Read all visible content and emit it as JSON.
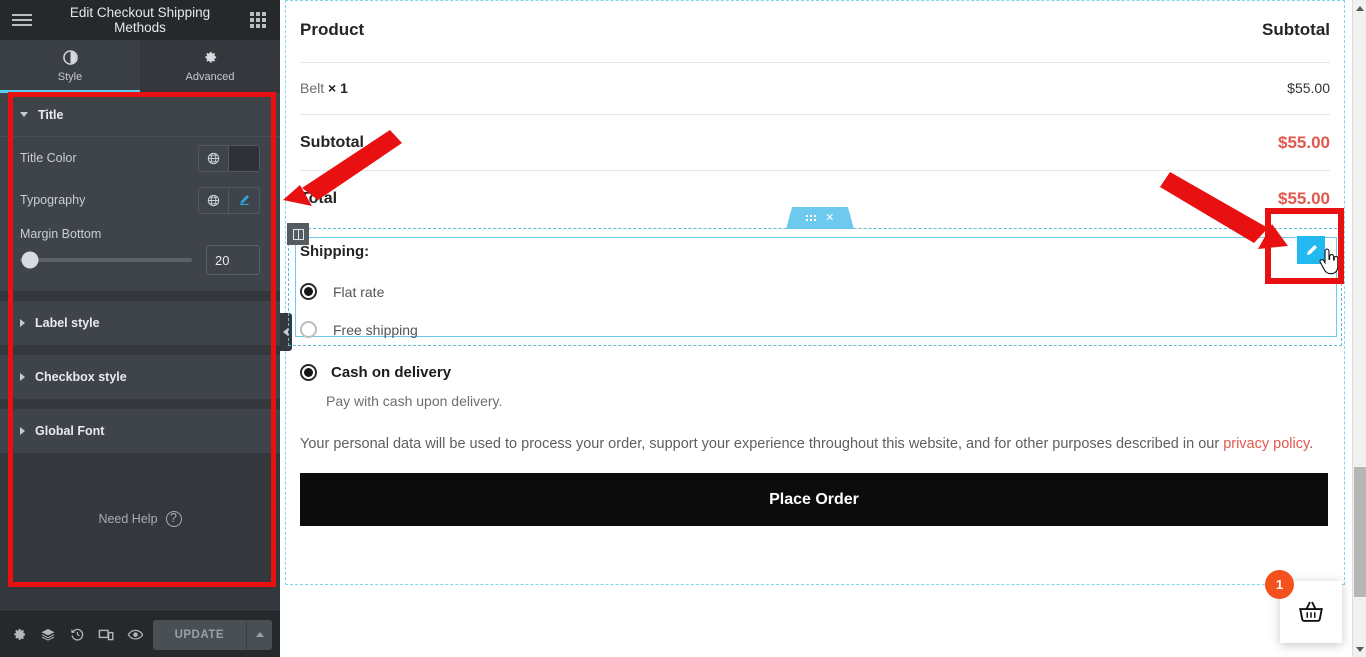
{
  "panel": {
    "header": {
      "title": "Edit Checkout Shipping Methods",
      "burger_icon": "hamburger-menu-icon",
      "apps_icon": "apps-grid-icon"
    },
    "tabs": [
      {
        "label": "Style",
        "icon": "contrast-icon",
        "active": true
      },
      {
        "label": "Advanced",
        "icon": "gear-icon",
        "active": false
      }
    ],
    "sections": [
      {
        "title": "Title",
        "expanded": true,
        "controls": [
          {
            "label": "Title Color",
            "type": "color",
            "globe_icon": "globe-icon",
            "swatch": "#2f3337"
          },
          {
            "label": "Typography",
            "type": "typography",
            "globe_icon": "globe-icon",
            "pencil_icon": "pencil-icon"
          },
          {
            "label": "Margin Bottom",
            "type": "slider",
            "value": "20",
            "slider_pct": 4
          }
        ]
      },
      {
        "title": "Label style",
        "expanded": false
      },
      {
        "title": "Checkbox style",
        "expanded": false
      },
      {
        "title": "Global Font",
        "expanded": false
      }
    ],
    "need_help": {
      "label": "Need Help",
      "icon": "question-circle-icon"
    },
    "footer": {
      "icons": [
        {
          "name": "settings-icon",
          "glyph": "⚙"
        },
        {
          "name": "layers-icon",
          "glyph": "≣"
        },
        {
          "name": "history-icon",
          "glyph": "↺"
        },
        {
          "name": "responsive-icon",
          "glyph": "❐"
        },
        {
          "name": "preview-eye-icon",
          "glyph": "◉"
        }
      ],
      "update_label": "UPDATE",
      "update_caret": "caret-up-icon"
    }
  },
  "canvas": {
    "collapse_icon": "chevron-left-icon",
    "order_table": {
      "headers": [
        "Product",
        "Subtotal"
      ],
      "items": [
        {
          "name": "Belt",
          "qty": "× 1",
          "price": "$55.00"
        }
      ],
      "summary": [
        {
          "label": "Subtotal",
          "value": "$55.00"
        },
        {
          "label": "Total",
          "value": "$55.00"
        }
      ]
    },
    "widget_tab": {
      "drag_icon": "drag-dots-icon",
      "close_icon": "close-x-icon"
    },
    "column_handle_icon": "column-handle-icon",
    "edit_pencil_icon": "pencil-edit-icon",
    "cursor_icon": "pointing-hand-cursor",
    "shipping": {
      "label": "Shipping:",
      "options": [
        {
          "label": "Flat rate",
          "selected": true
        },
        {
          "label": "Free shipping",
          "selected": false
        }
      ]
    },
    "payment": {
      "method": "Cash on delivery",
      "selected": true,
      "description": "Pay with cash upon delivery.",
      "privacy_text_before": "Your personal data will be used to process your order, support your experience throughout this website, and for other purposes described in our ",
      "privacy_link": "privacy policy",
      "privacy_text_after": ".",
      "place_order_label": "Place Order"
    },
    "cart": {
      "count": "1",
      "icon": "shopping-basket-icon"
    }
  },
  "scrollbar": {
    "up_icon": "scroll-up-arrow",
    "down_icon": "scroll-down-arrow"
  },
  "colors": {
    "accent_cyan": "#21b9ef",
    "panel_bg": "#34383c",
    "section_bg": "#3f444a",
    "price_red": "#e2574c",
    "annotation_red": "#e81010",
    "badge_orange": "#f4511e"
  }
}
